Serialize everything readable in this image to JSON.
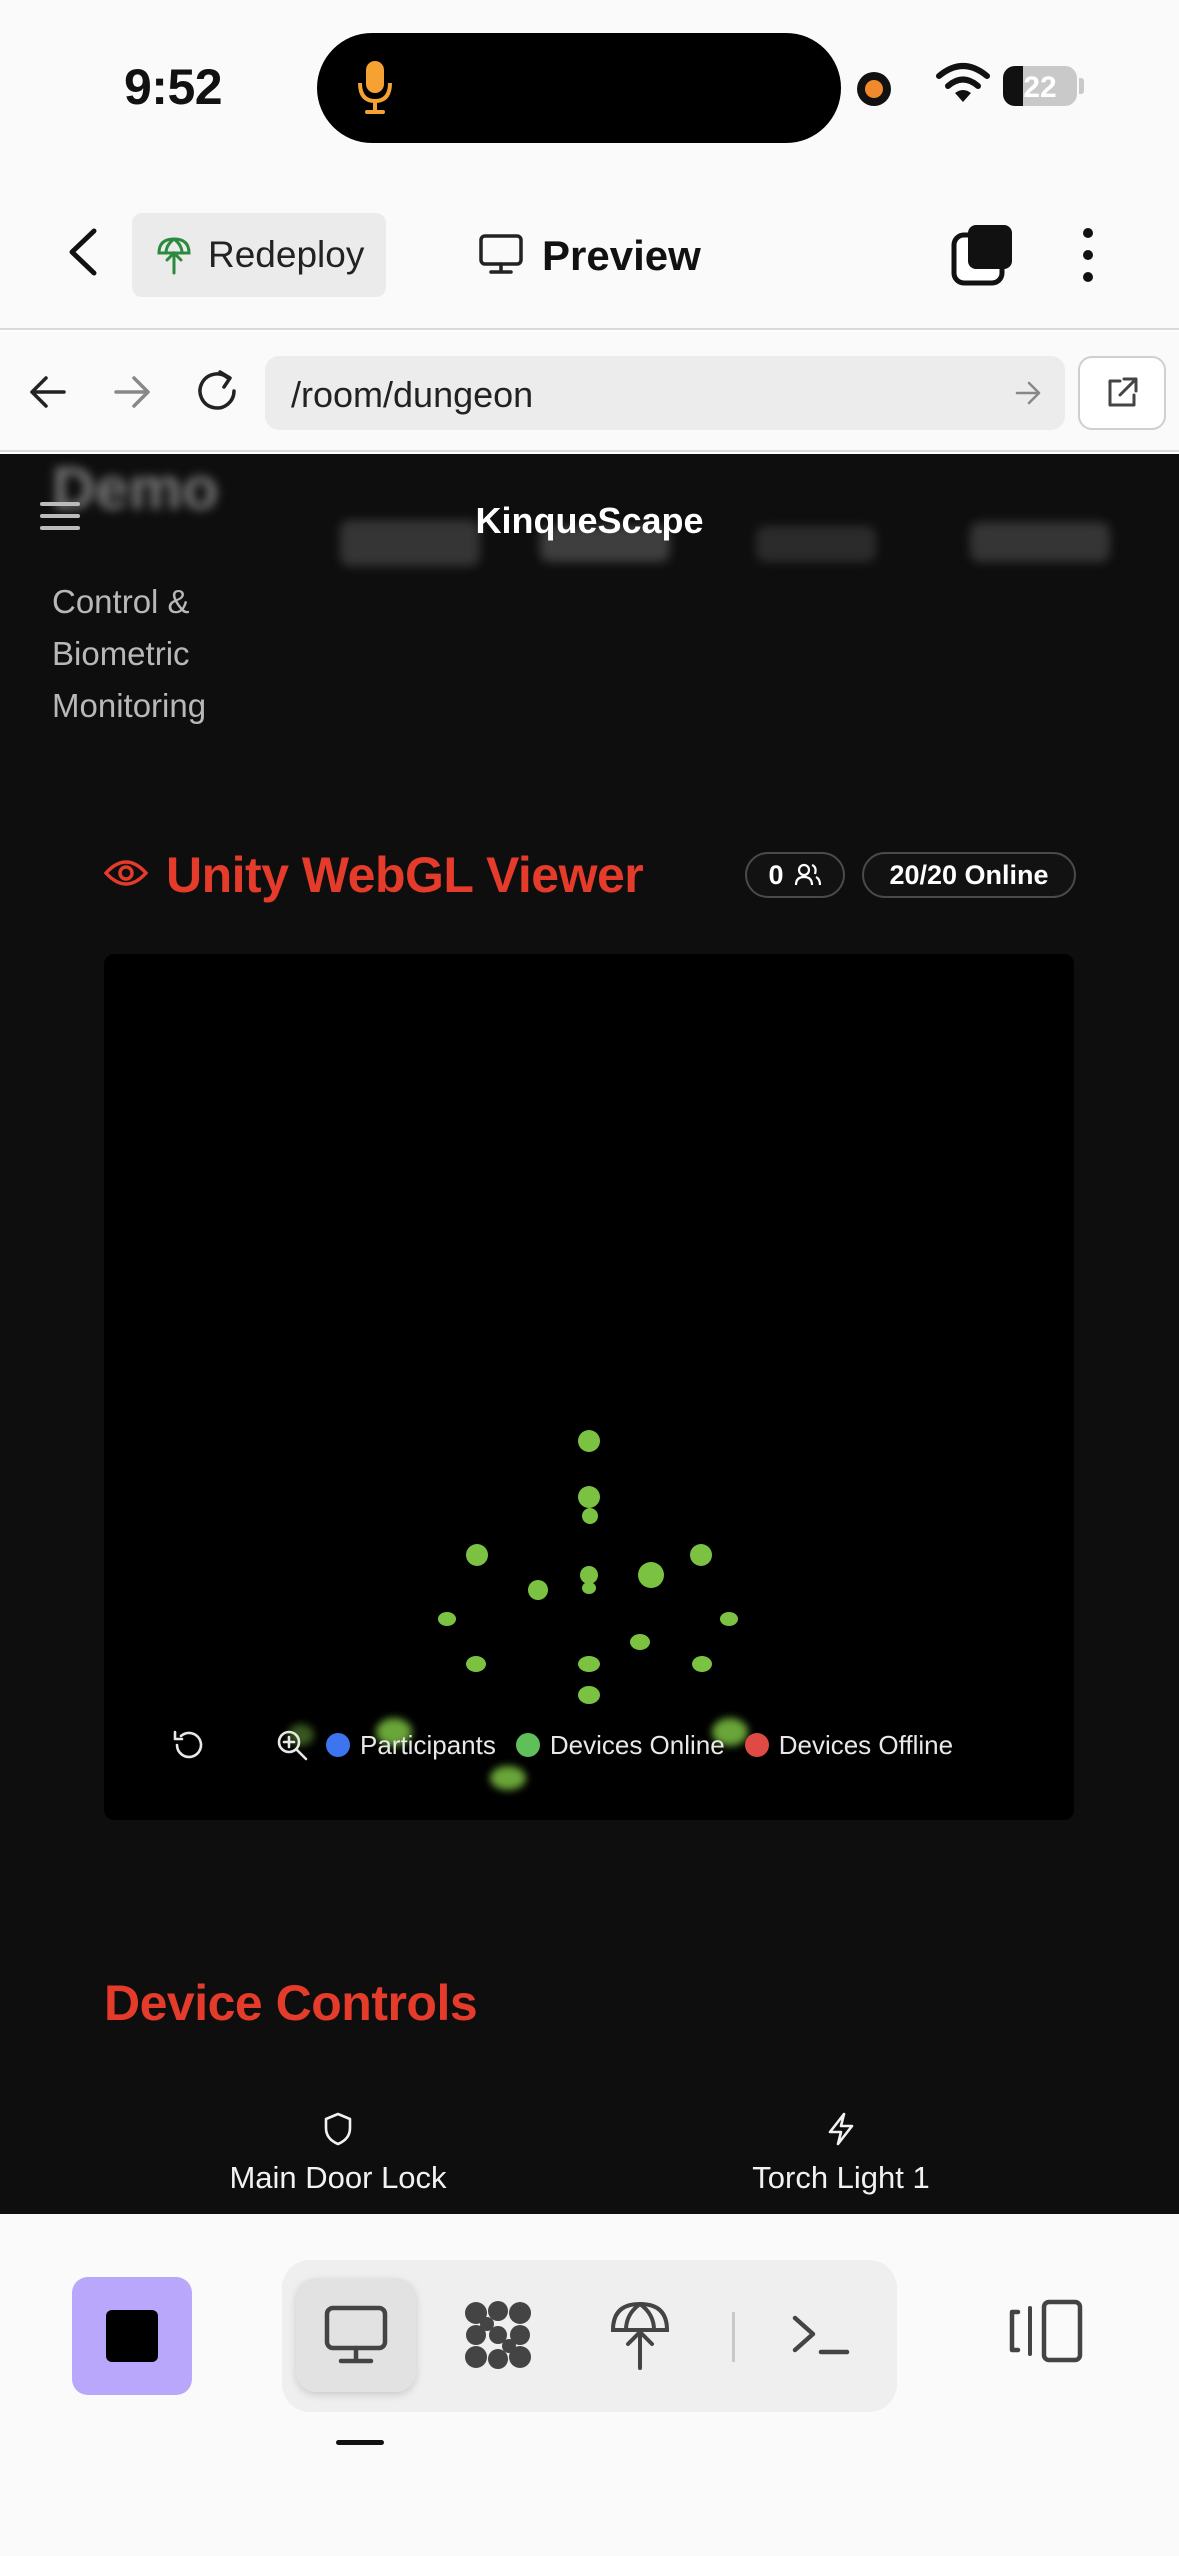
{
  "status_bar": {
    "time": "9:52",
    "battery": "22"
  },
  "header": {
    "redeploy_label": "Redeploy",
    "preview_label": "Preview"
  },
  "browser": {
    "url": "/room/dungeon"
  },
  "site": {
    "brand": "KinqueScape",
    "blurred_title": "Demo",
    "side_description": "Control & Biometric Monitoring"
  },
  "viewer": {
    "title": "Unity WebGL Viewer",
    "participants_count": "0",
    "online_badge": "20/20 Online",
    "legend": [
      {
        "label": "Participants",
        "color": "#3d74f0"
      },
      {
        "label": "Devices Online",
        "color": "#5fc05a"
      },
      {
        "label": "Devices Offline",
        "color": "#e04a44"
      }
    ]
  },
  "device_controls": {
    "title": "Device Controls",
    "items": [
      {
        "label": "Main Door Lock",
        "icon": "shield-icon"
      },
      {
        "label": "Torch Light 1",
        "icon": "lightning-icon"
      }
    ]
  },
  "toolbar": {
    "tools": [
      "monitor-icon",
      "network-icon",
      "deploy-icon",
      "terminal-icon"
    ],
    "active_tool": "monitor-icon"
  },
  "colors": {
    "accent_red": "#e53b2b",
    "device_green": "#7cc242",
    "stop_purple": "#b9a7fb"
  }
}
